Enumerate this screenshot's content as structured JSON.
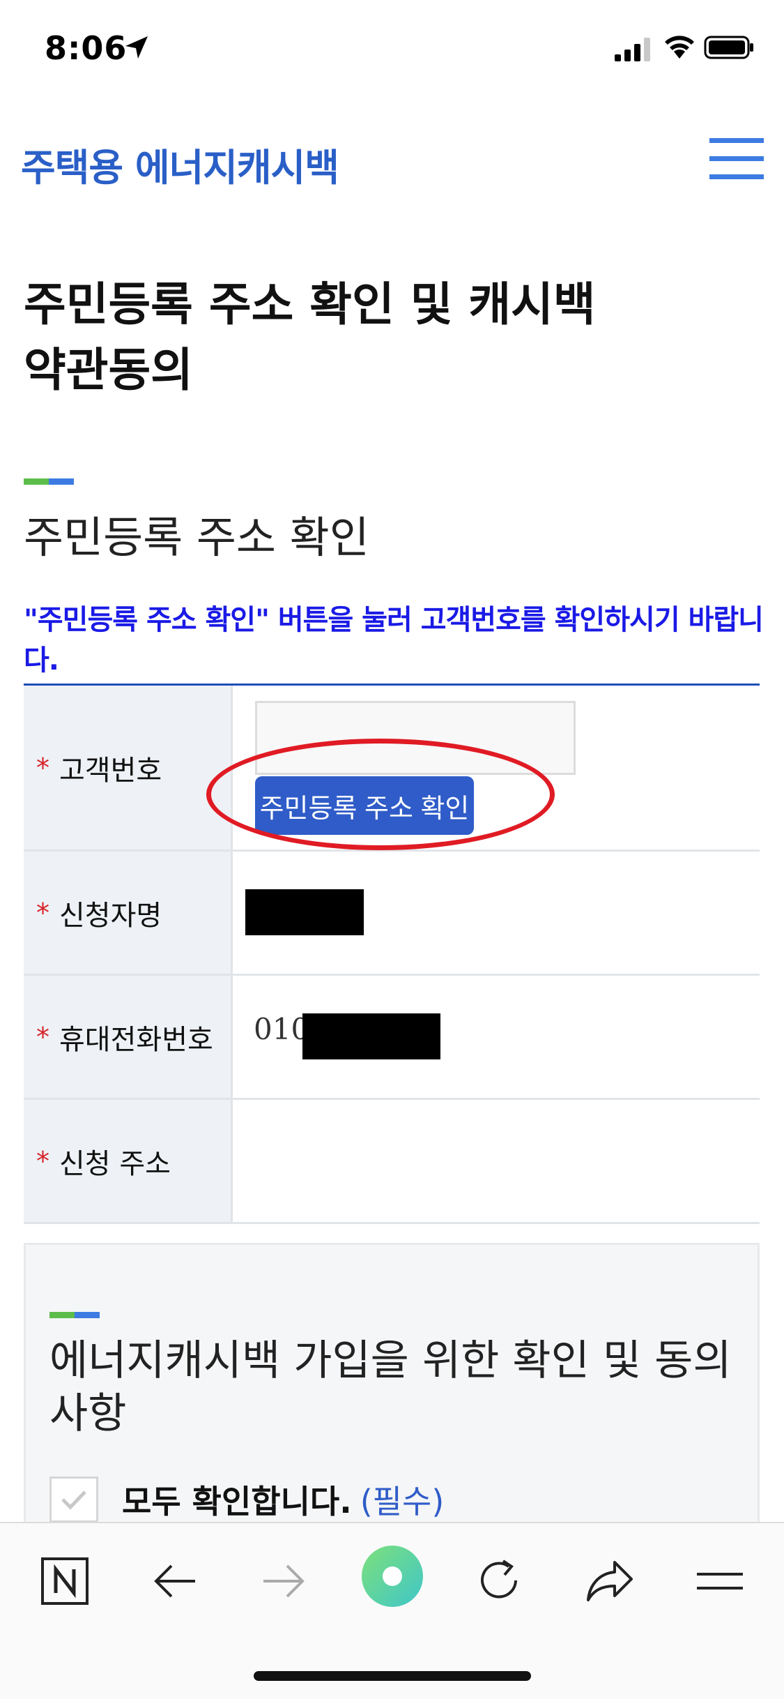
{
  "status_bar": {
    "time": "8:06"
  },
  "header": {
    "logo_text": "주택용 에너지캐시백"
  },
  "page": {
    "title": "주민등록 주소 확인 및 캐시백 약관동의"
  },
  "section": {
    "title": "주민등록 주소 확인",
    "notice": "\"주민등록 주소 확인\" 버튼을 눌러 고객번호를 확인하시기 바랍니다."
  },
  "form": {
    "required_mark": "*",
    "rows": [
      {
        "label": "고객번호",
        "value": ""
      },
      {
        "label": "신청자명",
        "value": ""
      },
      {
        "label": "휴대전화번호",
        "value": "010"
      },
      {
        "label": "신청 주소",
        "value": ""
      }
    ],
    "verify_button_label": "주민등록 주소 확인"
  },
  "agreement": {
    "title": "에너지캐시백 가입을 위한 확인 및 동의사항",
    "check_all_label": "모두 확인합니다.",
    "check_all_required": "(필수)"
  },
  "colors": {
    "brand_blue": "#2a5fc7",
    "button_blue": "#2f5cc8",
    "notice_blue": "#1a1ae6",
    "highlight_red": "#e01b24",
    "accent_green": "#5cbd4a"
  },
  "toolbar": {
    "icons": [
      "naver-n-icon",
      "back-arrow-icon",
      "forward-arrow-icon",
      "green-dot-icon",
      "reload-icon",
      "share-icon",
      "menu-icon"
    ]
  }
}
